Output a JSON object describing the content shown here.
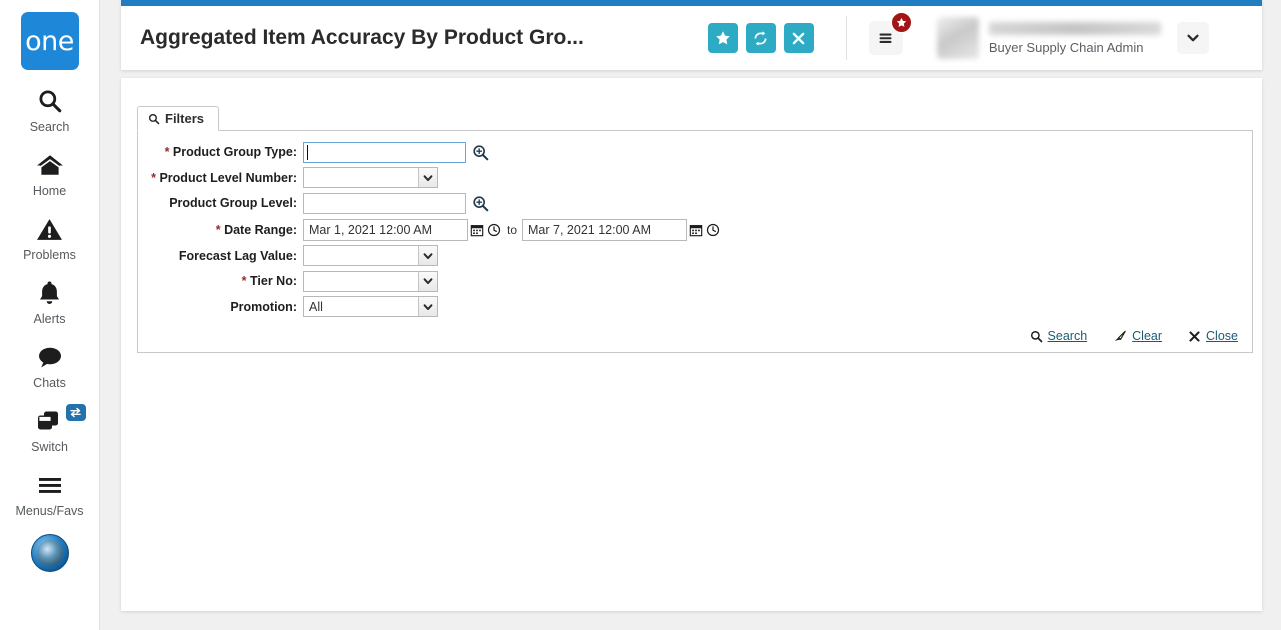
{
  "sidebar": {
    "logo_text": "one",
    "items": [
      {
        "icon": "search-icon",
        "label": "Search"
      },
      {
        "icon": "home-icon",
        "label": "Home"
      },
      {
        "icon": "problems-icon",
        "label": "Problems"
      },
      {
        "icon": "alerts-icon",
        "label": "Alerts"
      },
      {
        "icon": "chats-icon",
        "label": "Chats"
      },
      {
        "icon": "switch-icon",
        "label": "Switch"
      },
      {
        "icon": "menus-favs-icon",
        "label": "Menus/Favs"
      }
    ],
    "avatar_name": "user-avatar-badge"
  },
  "header": {
    "title": "Aggregated Item Accuracy By Product Gro...",
    "accent_color": "#1f7ec2",
    "button_color": "#2daac4",
    "badge_color": "#a31515",
    "actions": [
      {
        "name": "favorite-button",
        "icon": "star-icon"
      },
      {
        "name": "refresh-button",
        "icon": "refresh-icon"
      },
      {
        "name": "close-button",
        "icon": "close-icon"
      }
    ],
    "menu_button": {
      "icon": "list-menu-icon",
      "badge_icon": "star-icon"
    },
    "user": {
      "name": "",
      "role": "Buyer Supply Chain Admin"
    },
    "chevron": "chevron-down-icon"
  },
  "filters_tab": {
    "label": "Filters",
    "icon": "search-icon"
  },
  "filters": {
    "product_group_type": {
      "label": "Product Group Type:",
      "required": true,
      "value": "",
      "placeholder": "",
      "control": "text-lookup",
      "focused": true
    },
    "product_level_number": {
      "label": "Product Level Number:",
      "required": true,
      "value": "",
      "control": "select"
    },
    "product_group_level": {
      "label": "Product Group Level:",
      "required": false,
      "value": "",
      "placeholder": "",
      "control": "text-lookup"
    },
    "date_range": {
      "label": "Date Range:",
      "required": true,
      "from": "Mar 1, 2021 12:00 AM",
      "to": "Mar 7, 2021 12:00 AM",
      "separator": "to",
      "control": "date-range"
    },
    "forecast_lag_value": {
      "label": "Forecast Lag Value:",
      "required": false,
      "value": "",
      "control": "select"
    },
    "tier_no": {
      "label": "Tier No:",
      "required": true,
      "value": "",
      "control": "select"
    },
    "promotion": {
      "label": "Promotion:",
      "required": false,
      "value": "All",
      "control": "select"
    }
  },
  "panel_actions": [
    {
      "name": "search-link",
      "label": "Search",
      "icon": "search-icon"
    },
    {
      "name": "clear-link",
      "label": "Clear",
      "icon": "eraser-icon"
    },
    {
      "name": "close-link",
      "label": "Close",
      "icon": "close-x-icon"
    }
  ]
}
